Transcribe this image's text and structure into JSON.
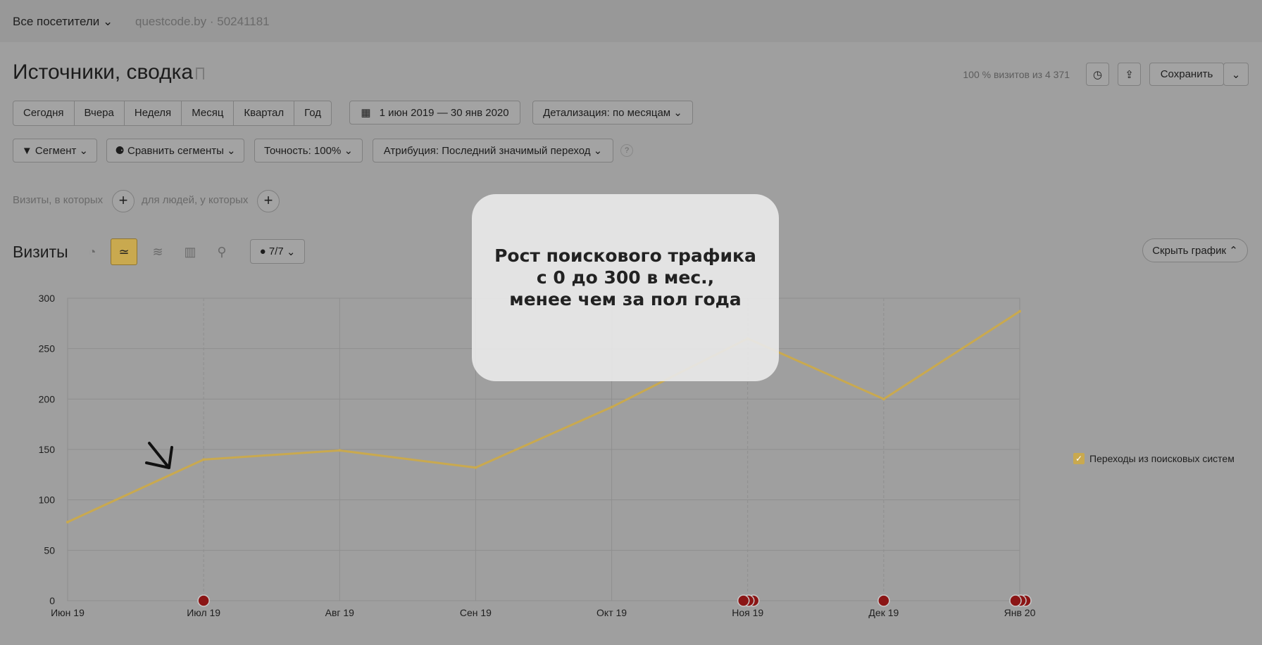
{
  "header": {
    "segment_select": "Все посетители",
    "counter_label": "questcode.by · 50241181"
  },
  "report": {
    "title": "Источники, сводка",
    "visits_info": "100 % визитов из 4 371",
    "save_label": "Сохранить"
  },
  "periods": [
    "Сегодня",
    "Вчера",
    "Неделя",
    "Месяц",
    "Квартал",
    "Год"
  ],
  "date_range": "1 июн 2019 — 30 янв 2020",
  "detail": "Детализация: по месяцам",
  "filters": {
    "segment": "Сегмент",
    "compare": "Сравнить сегменты",
    "accuracy": "Точность: 100%",
    "attribution": "Атрибуция: Последний значимый переход",
    "help": "?"
  },
  "conditions": {
    "visits_label": "Визиты, в которых",
    "people_label": "для людей, у которых"
  },
  "chart_section": {
    "title": "Визиты",
    "comments_count": "7/7",
    "hide_chart": "Скрыть график"
  },
  "icons": [
    "pie-chart-icon",
    "line-chart-icon",
    "area-chart-icon",
    "bar-chart-icon",
    "map-icon",
    "comment-icon",
    "clock-icon",
    "export-icon",
    "bookmark-icon",
    "filter-icon",
    "segments-icon",
    "calendar-icon",
    "plus-icon",
    "chevron-down-icon",
    "chevron-up-icon",
    "arrow-icon"
  ],
  "overlay": {
    "text": "Рост поискового трафика\nс 0 до 300 в мес.,\nменее чем за пол года"
  },
  "chart_data": {
    "type": "line",
    "categories": [
      "Июн 19",
      "Июл 19",
      "Авг 19",
      "Сен 19",
      "Окт 19",
      "Ноя 19",
      "Дек 19",
      "Янв 20"
    ],
    "series": [
      {
        "name": "Переходы из поисковых систем",
        "values": [
          78,
          140,
          149,
          132,
          192,
          260,
          200,
          287
        ],
        "color": "#c9a94f"
      }
    ],
    "ylim": [
      0,
      300
    ],
    "yticks": [
      0,
      50,
      100,
      150,
      200,
      250,
      300
    ],
    "grid": true,
    "legend": "right"
  }
}
